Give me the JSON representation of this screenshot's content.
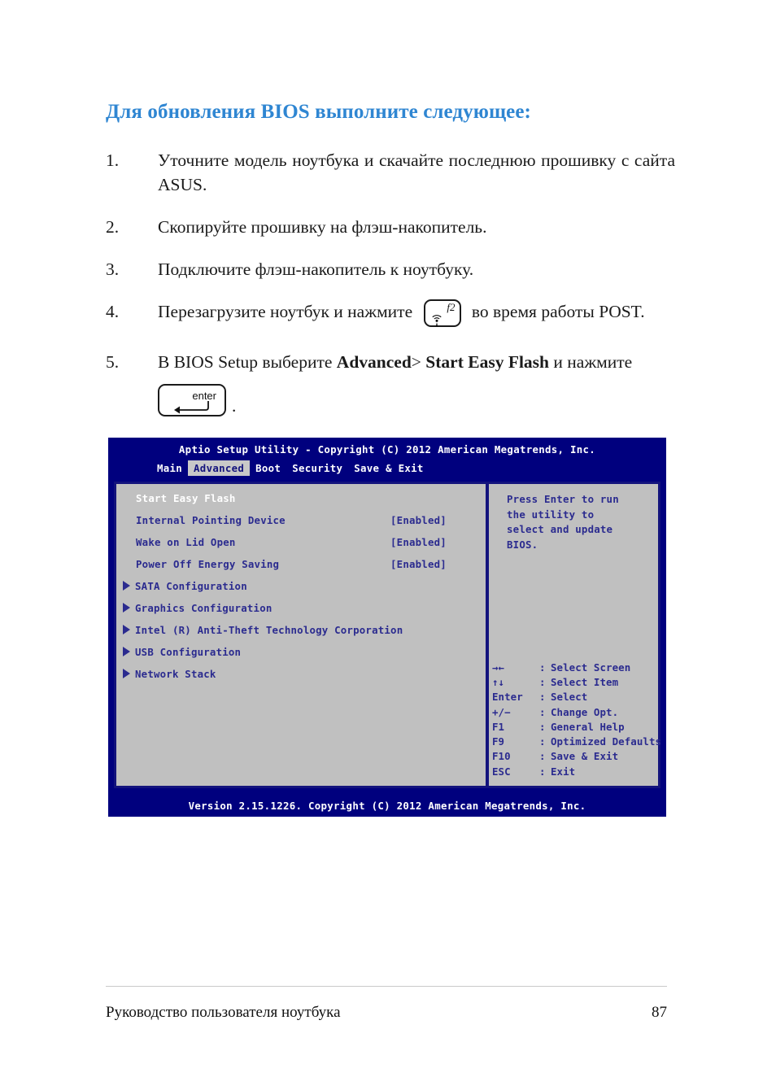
{
  "heading": "Для обновления BIOS выполните следующее:",
  "steps": [
    {
      "num": "1.",
      "text": "Уточните модель ноутбука и скачайте последнюю прошивку с сайта ASUS."
    },
    {
      "num": "2.",
      "text": "Скопируйте прошивку на флэш-накопитель."
    },
    {
      "num": "3.",
      "text": "Подключите флэш-накопитель к ноутбуку."
    },
    {
      "num": "4.",
      "text_before": "Перезагрузите ноутбук и нажмите",
      "key": "f2",
      "key_icon": "wifi-antenna-icon",
      "text_after": "во время работы POST."
    },
    {
      "num": "5.",
      "text_before": "В BIOS Setup выберите",
      "bold_1": "Advanced",
      "separator": ">",
      "bold_2": "Start Easy Flash",
      "text_after": "и нажмите",
      "key": "enter",
      "key_icon": "enter-arrow-icon",
      "trailing": "."
    }
  ],
  "bios": {
    "title": "Aptio Setup Utility - Copyright (C) 2012 American Megatrends, Inc.",
    "tabs": [
      {
        "label": "Main",
        "active": false
      },
      {
        "label": "Advanced",
        "active": true
      },
      {
        "label": "Boot",
        "active": false
      },
      {
        "label": "Security",
        "active": false
      },
      {
        "label": "Save & Exit",
        "active": false
      }
    ],
    "menu": [
      {
        "label": "Start Easy Flash",
        "value": "",
        "submenu": false,
        "selected": true
      },
      {
        "label": "Internal Pointing Device",
        "value": "[Enabled]",
        "submenu": false,
        "selected": false
      },
      {
        "label": "Wake on Lid Open",
        "value": "[Enabled]",
        "submenu": false,
        "selected": false
      },
      {
        "label": "Power Off Energy Saving",
        "value": "[Enabled]",
        "submenu": false,
        "selected": false
      },
      {
        "label": "SATA Configuration",
        "value": "",
        "submenu": true,
        "selected": false
      },
      {
        "label": "Graphics Configuration",
        "value": "",
        "submenu": true,
        "selected": false
      },
      {
        "label": "Intel (R) Anti-Theft Technology Corporation",
        "value": "",
        "submenu": true,
        "selected": false
      },
      {
        "label": "USB Configuration",
        "value": "",
        "submenu": true,
        "selected": false
      },
      {
        "label": "Network Stack",
        "value": "",
        "submenu": true,
        "selected": false
      }
    ],
    "help": "Press Enter to run\nthe utility to\nselect and update\nBIOS.",
    "keys": [
      {
        "key": "→←",
        "colon": ":",
        "desc": "Select Screen"
      },
      {
        "key": "↑↓",
        "colon": ":",
        "desc": "Select Item"
      },
      {
        "key": "Enter",
        "colon": ":",
        "desc": "Select"
      },
      {
        "key": "+/−",
        "colon": ":",
        "desc": "Change Opt."
      },
      {
        "key": "F1",
        "colon": ":",
        "desc": "General Help"
      },
      {
        "key": "F9",
        "colon": ":",
        "desc": "Optimized Defaults"
      },
      {
        "key": "F10",
        "colon": ":",
        "desc": "Save & Exit"
      },
      {
        "key": "ESC",
        "colon": ":",
        "desc": "Exit"
      }
    ],
    "footer": "Version 2.15.1226. Copyright (C) 2012 American Megatrends, Inc."
  },
  "page_footer": {
    "left": "Руководство пользователя ноутбука",
    "page_number": "87"
  },
  "colors": {
    "heading_blue": "#2f86d2",
    "bios_navy": "#00007e",
    "bios_border": "#13137d",
    "bios_panel_gray": "#c0c0c0",
    "bios_text_blue": "#2b2b8f",
    "bios_tab_active_bg": "#c8c8c8"
  }
}
